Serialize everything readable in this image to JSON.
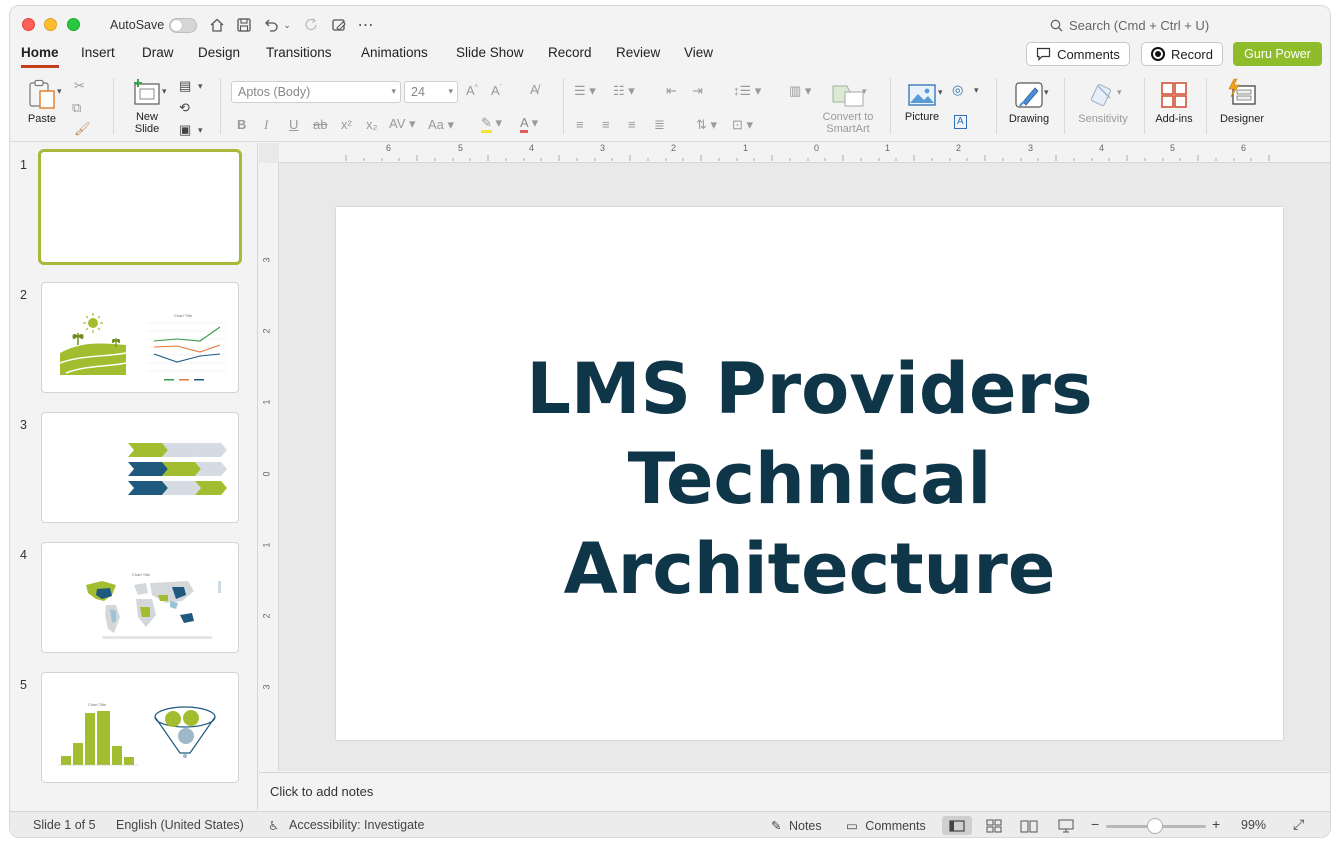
{
  "titlebar": {
    "autosave_label": "AutoSave",
    "search_placeholder": "Search (Cmd + Ctrl + U)"
  },
  "tabs": [
    {
      "label": "Home",
      "active": true
    },
    {
      "label": "Insert"
    },
    {
      "label": "Draw"
    },
    {
      "label": "Design"
    },
    {
      "label": "Transitions"
    },
    {
      "label": "Animations"
    },
    {
      "label": "Slide Show"
    },
    {
      "label": "Record"
    },
    {
      "label": "Review"
    },
    {
      "label": "View"
    }
  ],
  "header_buttons": {
    "comments": "Comments",
    "record": "Record",
    "guru": "Guru Power"
  },
  "ribbon": {
    "paste": "Paste",
    "new_slide_1": "New",
    "new_slide_2": "Slide",
    "font_name": "Aptos (Body)",
    "font_size": "24",
    "convert_1": "Convert to",
    "convert_2": "SmartArt",
    "picture": "Picture",
    "drawing": "Drawing",
    "sensitivity": "Sensitivity",
    "addins": "Add-ins",
    "designer": "Designer"
  },
  "thumbnails": [
    {
      "number": "1",
      "selected": true
    },
    {
      "number": "2",
      "chart_title": "Chart Title"
    },
    {
      "number": "3"
    },
    {
      "number": "4",
      "chart_title": "Chart Title"
    },
    {
      "number": "5",
      "chart_title": "Chart Title"
    }
  ],
  "ruler": {
    "horizontal": [
      "6",
      "5",
      "4",
      "3",
      "2",
      "1",
      "0",
      "1",
      "2",
      "3",
      "4",
      "5",
      "6"
    ],
    "vertical": [
      "3",
      "2",
      "1",
      "0",
      "1",
      "2",
      "3"
    ]
  },
  "slide": {
    "title_line1": "LMS Providers",
    "title_line2": "Technical",
    "title_line3": "Architecture",
    "title_color": "#0f3549"
  },
  "notes_placeholder": "Click to add notes",
  "status": {
    "slide_info": "Slide 1 of 5",
    "language": "English (United States)",
    "accessibility": "Accessibility: Investigate",
    "notes": "Notes",
    "comments": "Comments",
    "zoom": "99%"
  },
  "colors": {
    "accent_green": "#8fbc2b",
    "tab_underline": "#c43e1c",
    "dark_blue": "#1f5a7e"
  }
}
